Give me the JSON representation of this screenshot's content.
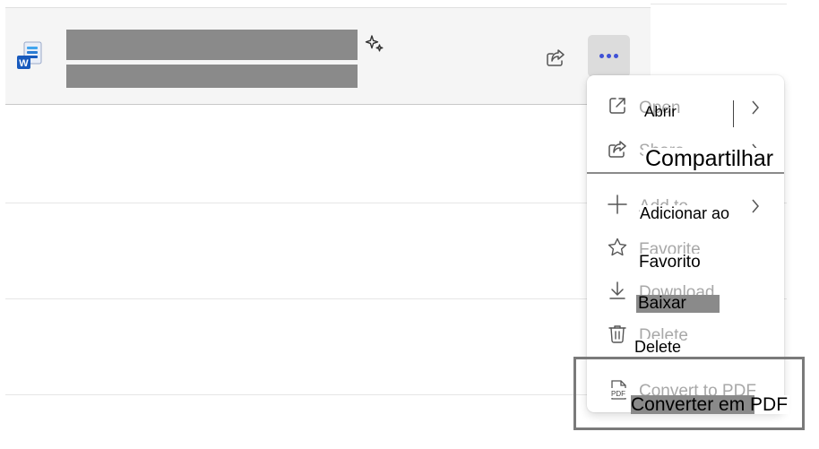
{
  "file_row": {
    "file_type_icon": "word-document-icon",
    "actions": {
      "sparkle_icon": "sparkle-icon",
      "share_icon": "share-icon",
      "more_icon": "more-horizontal-icon"
    }
  },
  "menu": {
    "items": [
      {
        "en": "Open",
        "pt": "Abrir",
        "icon": "open-in-new-icon",
        "has_submenu": true
      },
      {
        "en": "Share",
        "pt": "Compartilhar",
        "icon": "share-icon",
        "has_submenu": true
      },
      {
        "en": "Add to",
        "pt": "Adicionar ao",
        "icon": "plus-icon",
        "has_submenu": true
      },
      {
        "en": "Favorite",
        "pt": "Favorito",
        "icon": "star-icon",
        "has_submenu": false
      },
      {
        "en": "Download",
        "pt": "Baixar",
        "icon": "download-icon",
        "has_submenu": false
      },
      {
        "en": "Delete",
        "pt": "Delete",
        "icon": "trash-icon",
        "has_submenu": false
      },
      {
        "en": "Convert to PDF",
        "pt": "Converter em PDF",
        "icon": "pdf-icon",
        "has_submenu": false
      }
    ]
  },
  "colors": {
    "accent": "#3f51d6",
    "redaction": "#8a8a8a",
    "highlight_border": "#7a7a7a",
    "word_blue": "#185abd"
  }
}
